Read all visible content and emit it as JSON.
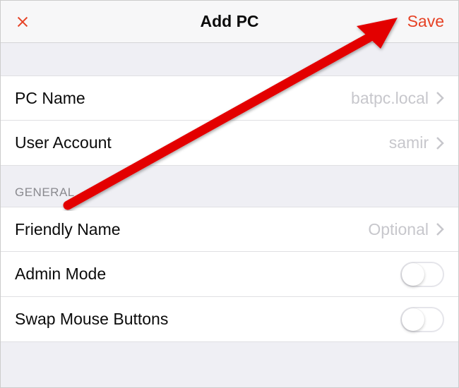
{
  "header": {
    "title": "Add PC",
    "save_label": "Save"
  },
  "connection": {
    "pc_name": {
      "label": "PC Name",
      "value": "batpc.local"
    },
    "user_account": {
      "label": "User Account",
      "value": "samir"
    }
  },
  "general": {
    "section_title": "General",
    "friendly_name": {
      "label": "Friendly Name",
      "placeholder": "Optional"
    },
    "admin_mode": {
      "label": "Admin Mode",
      "enabled": false
    },
    "swap_mouse": {
      "label": "Swap Mouse Buttons",
      "enabled": false
    }
  },
  "annotation": {
    "arrow_color": "#e30000"
  }
}
